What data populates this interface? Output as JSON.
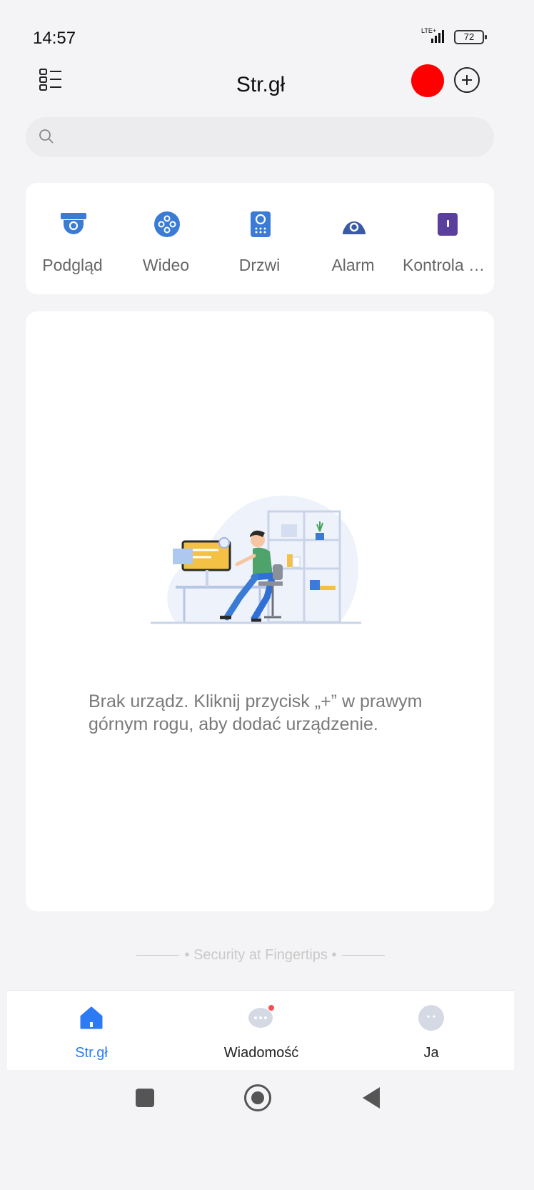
{
  "status_bar": {
    "time": "14:57",
    "network": "LTE+",
    "battery": "72"
  },
  "header": {
    "title": "Str.gł",
    "icons": {
      "menu": "list-menu-icon",
      "record": "red-record-dot",
      "add": "plus-circle-icon"
    },
    "record_color": "#ff0000"
  },
  "search": {
    "placeholder": "",
    "icon": "search-icon"
  },
  "categories": [
    {
      "label": "Podgląd",
      "icon": "camera-dome-icon"
    },
    {
      "label": "Wideo",
      "icon": "video-reel-icon"
    },
    {
      "label": "Drzwi",
      "icon": "door-intercom-icon"
    },
    {
      "label": "Alarm",
      "icon": "alarm-icon"
    },
    {
      "label": "Kontrola d...",
      "icon": "access-control-icon"
    }
  ],
  "empty_state": {
    "message": "Brak urządz. Kliknij przycisk „+” w prawym górnym rogu, aby dodać urządzenie.",
    "illustration": "person-at-desk-illustration"
  },
  "slogan": "Security at Fingertips",
  "tabs": [
    {
      "label": "Str.gł",
      "icon": "home-icon",
      "active": true
    },
    {
      "label": "Wiadomość",
      "icon": "message-bubble-icon",
      "active": false
    },
    {
      "label": "Ja",
      "icon": "profile-icon",
      "active": false
    }
  ],
  "colors": {
    "accent": "#2d7bf4",
    "icon_blue": "#3a7bd5",
    "icon_purple": "#5b3f9c",
    "notification": "#ff4d4f"
  },
  "system_nav": {
    "icons": [
      "recents-square-icon",
      "home-circle-icon",
      "back-triangle-icon"
    ]
  }
}
